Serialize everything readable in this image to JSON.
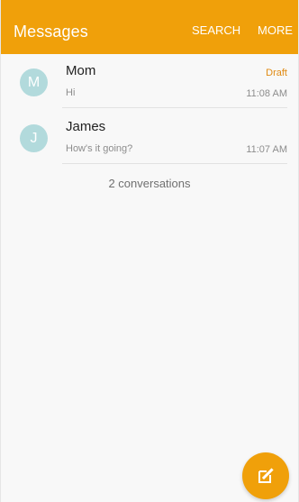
{
  "header": {
    "title": "Messages",
    "actions": [
      "SEARCH",
      "MORE"
    ]
  },
  "conversations": [
    {
      "avatar_letter": "M",
      "name": "Mom",
      "snippet": "Hi",
      "status": "Draft",
      "time": "11:08 AM"
    },
    {
      "avatar_letter": "J",
      "name": "James",
      "snippet": "How's it going?",
      "time": "11:07 AM"
    }
  ],
  "summary": {
    "count": "2 conversations"
  },
  "fab": {
    "icon": "compose-icon"
  },
  "colors": {
    "accent": "#f0a00a",
    "avatar": "#b2dadc",
    "draft": "#e08a12"
  }
}
